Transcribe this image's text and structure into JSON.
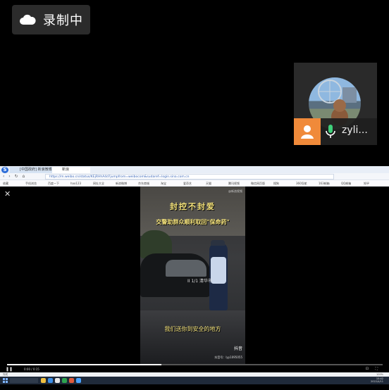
{
  "recording": {
    "label": "录制中",
    "icon": "cloud-icon"
  },
  "participant": {
    "name": "zyli...",
    "avatar_icon": "user-icon",
    "mic_icon": "microphone-icon"
  },
  "browser": {
    "tabs": [
      "[中国政府] 新浪微博...",
      "新浪"
    ],
    "url": "https://m.weibo.cn/status/KEjRHhA4d?jumpfrom=weibocom&sudaref=login.sina.com.cn",
    "bookmarks": [
      "收藏",
      "手机浏览",
      "百度一下",
      "hao123",
      "网址大全",
      "新浪微博",
      "京东商城",
      "淘宝",
      "爱奇艺",
      "天猫",
      "腾讯视频",
      "微信网页版",
      "搜狗",
      "360导航",
      "163邮箱",
      "QQ邮箱",
      "知乎"
    ]
  },
  "video": {
    "title": "封控不封爱",
    "subtitle": "交警助群众顺利取回\"保命药\"",
    "caption": "我们送你到安全的地方",
    "watermark": "@新浪视频",
    "status_text": "II 1/1 清华市",
    "platform": "抖音",
    "user_id": "抖音号：lyy1095055",
    "progress": 0.41,
    "time": "0:00 / 0:15",
    "close_icon": "close-icon",
    "play_icon": "pause-icon"
  },
  "statusbar": {
    "left": "完成",
    "right": "100%"
  },
  "taskbar": {
    "time": "15:42",
    "date": "2022/4/11"
  }
}
